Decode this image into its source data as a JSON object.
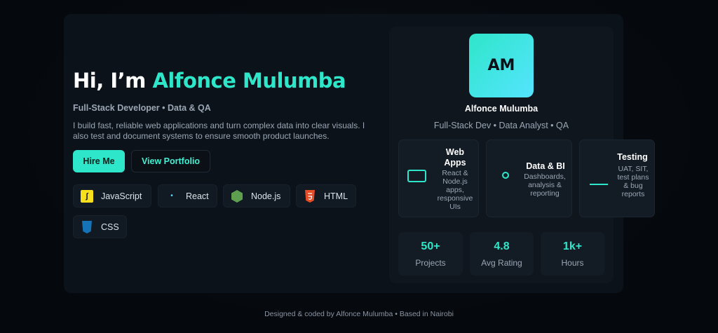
{
  "hero": {
    "greeting": "Hi, I’m",
    "name": "Alfonce Mulumba",
    "subtitle": "Full-Stack Developer • Data & QA",
    "bio": "I build fast, reliable web applications and turn complex data into clear visuals. I also test and document systems to ensure smooth product launches.",
    "buttons": {
      "hire": "Hire Me",
      "portfolio": "View Portfolio"
    },
    "skills": [
      {
        "label": "JavaScript",
        "icon": "javascript-icon"
      },
      {
        "label": "React",
        "icon": "react-icon"
      },
      {
        "label": "Node.js",
        "icon": "nodejs-icon"
      },
      {
        "label": "HTML",
        "icon": "html5-icon"
      },
      {
        "label": "CSS",
        "icon": "css3-icon"
      }
    ]
  },
  "profile": {
    "initials": "AM",
    "name": "Alfonce Mulumba",
    "role": "Full-Stack Dev • Data Analyst • QA",
    "services": [
      {
        "title": "Web Apps",
        "desc": "React & Node.js apps, responsive UIs",
        "icon": "monitor-icon"
      },
      {
        "title": "Data & BI",
        "desc": "Dashboards, analysis & reporting",
        "icon": "circle-icon"
      },
      {
        "title": "Testing",
        "desc": "UAT, SIT, test plans & bug reports",
        "icon": "line-icon"
      }
    ],
    "stats": [
      {
        "value": "50+",
        "label": "Projects"
      },
      {
        "value": "4.8",
        "label": "Avg Rating"
      },
      {
        "value": "1k+",
        "label": "Hours"
      }
    ]
  },
  "footer": {
    "text": "Designed & coded by Alfonce Mulumba • Based in Nairobi"
  },
  "colors": {
    "accent": "#2ee6c9",
    "background": "#05080c",
    "card": "#0c1219",
    "muted_text": "#9aa6b4"
  }
}
